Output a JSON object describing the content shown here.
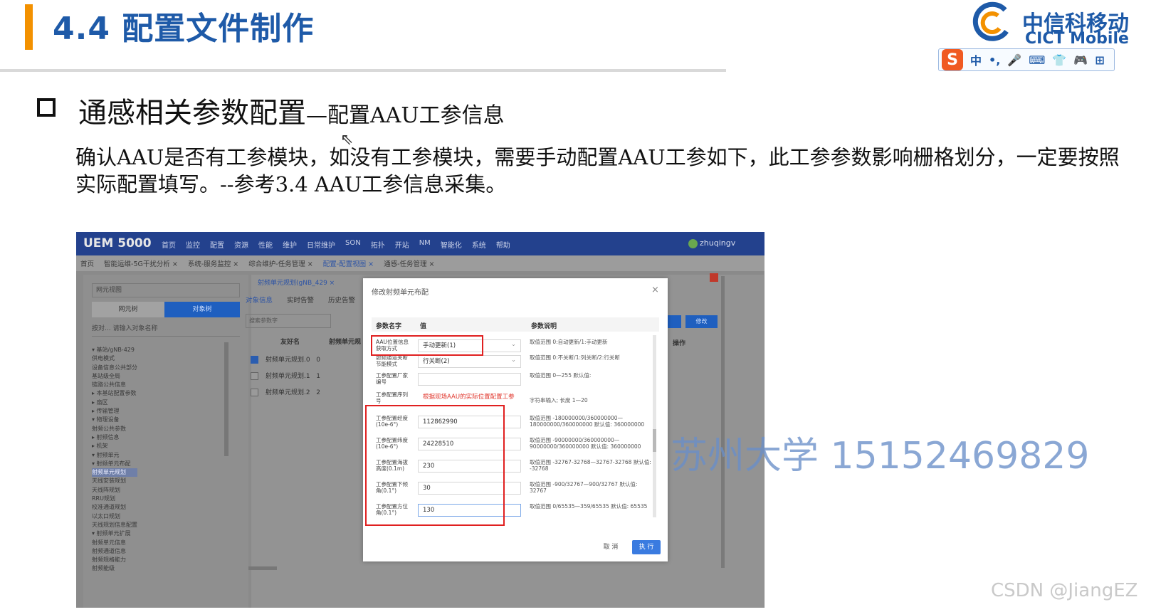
{
  "slide": {
    "title": "4.4 配置文件制作",
    "logo_cn": "中信科移动",
    "logo_en": "CICT Mobile",
    "ime_items": [
      "中",
      "•,",
      "🎤",
      "⌨",
      "👕",
      "🎮",
      "⊞"
    ],
    "heading_main": "通感相关参数配置",
    "heading_sub": "—配置AAU工参信息",
    "paragraph": "确认AAU是否有工参模块，如没有工参模块，需要手动配置AAU工参如下，此工参参数影响栅格划分，一定要按照实际配置填写。--参考3.4   AAU工参信息采集。"
  },
  "app": {
    "brand": "UEM 5000",
    "menu": [
      "首页",
      "监控",
      "配置",
      "资源",
      "性能",
      "维护",
      "日常维护",
      "SON",
      "拓扑",
      "开站",
      "NM",
      "智能化",
      "系统",
      "帮助"
    ],
    "user": "zhuqingv",
    "tabs": [
      "首页",
      "智能运维-5G干扰分析 ×",
      "系统-服务监控 ×",
      "综合维护-任务管理 ×",
      "配置-配置视图 ×",
      "通感-任务管理 ×"
    ],
    "active_tab": "配置-配置视图 ×",
    "left": {
      "search": "网元视图",
      "btn_tree": "网元树",
      "btn_obj": "对象树",
      "filter": "按对...   请输入对象名称",
      "tree": [
        "▾ 基站/gNB-429",
        "    供电模式",
        "    设备信息公共部分",
        "    基站级全局",
        "    链路公共信息",
        "  ▸ 本基站配置参数",
        "  ▸ 扇区",
        "  ▸ 传输管理",
        "  ▾ 物理设备",
        "      射频公共参数",
        "    ▸ 射频信息",
        "    ▸ 机架",
        "    ▾ 射频单元",
        "      ▾ 射频单元布配",
        "          射频单元规划",
        "          天线安装规划",
        "          天线阵规划",
        "          RRU规划",
        "          校准通道规划",
        "          以太口规划",
        "          天线规划信息配置",
        "      ▾ 射频单元扩展",
        "          射频单元信息",
        "          射频通道信息",
        "          射频规格能力",
        "          射频能级"
      ]
    },
    "right": {
      "breadcrumb": "射频单元规划(gNB_429  ×",
      "subtabs": [
        "对象信息",
        "实时告警",
        "历史告警"
      ],
      "search_placeholder": "搜索参数字",
      "col_name": "友好名",
      "col_unit": "射频单元规",
      "rows": [
        {
          "name": "射频单元规划.0",
          "val": "0",
          "checked": true
        },
        {
          "name": "射频单元规划.1",
          "val": "1",
          "checked": false
        },
        {
          "name": "射频单元规划.2",
          "val": "2",
          "checked": false
        }
      ],
      "btn_add": "修改",
      "ops": "操作"
    }
  },
  "dialog": {
    "title": "修改射频单元布配",
    "close": "×",
    "col_param": "参数名字",
    "col_value": "值",
    "col_desc": "参数说明",
    "rows": [
      {
        "name": "AAU位置信息获取方式",
        "value": "手动更新(1)",
        "desc": "取值范围 0:自动更新/1:手动更新"
      },
      {
        "name": "射频通道关断节能模式",
        "value": "行关断(2)",
        "desc": "取值范围 0:不关断/1:列关断/2:行关断"
      },
      {
        "name": "工参配置厂家编号",
        "value": "",
        "desc": "取值范围 0—255 默认值:"
      },
      {
        "name": "工参配置序列号",
        "value": "根据现场AAU的实际位置配置工参",
        "desc": "字符串输入; 长度 1—20"
      },
      {
        "name": "工参配置经度(10e-6°)",
        "value": "112862990",
        "desc": "取值范围 -180000000/360000000—180000000/360000000 默认值: 360000000"
      },
      {
        "name": "工参配置纬度(10e-6°)",
        "value": "24228510",
        "desc": "取值范围 -90000000/360000000—90000000/360000000 默认值: 360000000"
      },
      {
        "name": "工参配置海拔高度(0.1m)",
        "value": "230",
        "desc": "取值范围 -32767-32768—32767-32768 默认值: -32768"
      },
      {
        "name": "工参配置下倾角(0.1°)",
        "value": "30",
        "desc": "取值范围 -900/32767—900/32767 默认值: 32767"
      },
      {
        "name": "工参配置方位角(0.1°)",
        "value": "130",
        "desc": "取值范围 0/65535—359/65535 默认值: 65535"
      }
    ],
    "cancel": "取 消",
    "execute": "执 行"
  },
  "watermarks": {
    "phone": "苏州大学 15152469829",
    "csdn": "CSDN @JiangEZ"
  },
  "colors": {
    "title_blue": "#1e5aa8",
    "accent_orange": "#f39100",
    "highlight_red": "#e02020",
    "topbar": "#23418d"
  }
}
